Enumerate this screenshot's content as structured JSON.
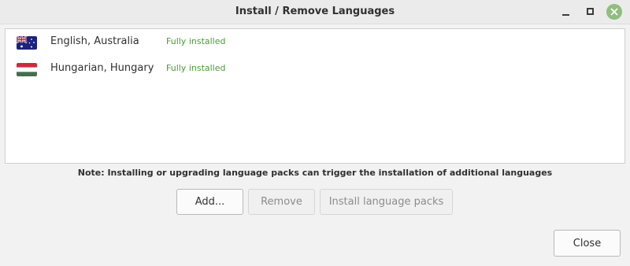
{
  "window": {
    "title": "Install / Remove Languages",
    "controls": [
      "minimize-icon",
      "maximize-icon",
      "close-icon"
    ],
    "close_color": "#8fbe7f"
  },
  "languages": [
    {
      "name": "English, Australia",
      "status": "Fully installed",
      "flag": "australia-flag-icon"
    },
    {
      "name": "Hungarian, Hungary",
      "status": "Fully installed",
      "flag": "hungary-flag-icon"
    }
  ],
  "note": "Note: Installing or upgrading language packs can trigger the installation of additional languages",
  "buttons": {
    "add": "Add...",
    "remove": "Remove",
    "install": "Install language packs",
    "close": "Close"
  },
  "colors": {
    "status_ok": "#4a9b37",
    "background": "#f2f2f2"
  }
}
